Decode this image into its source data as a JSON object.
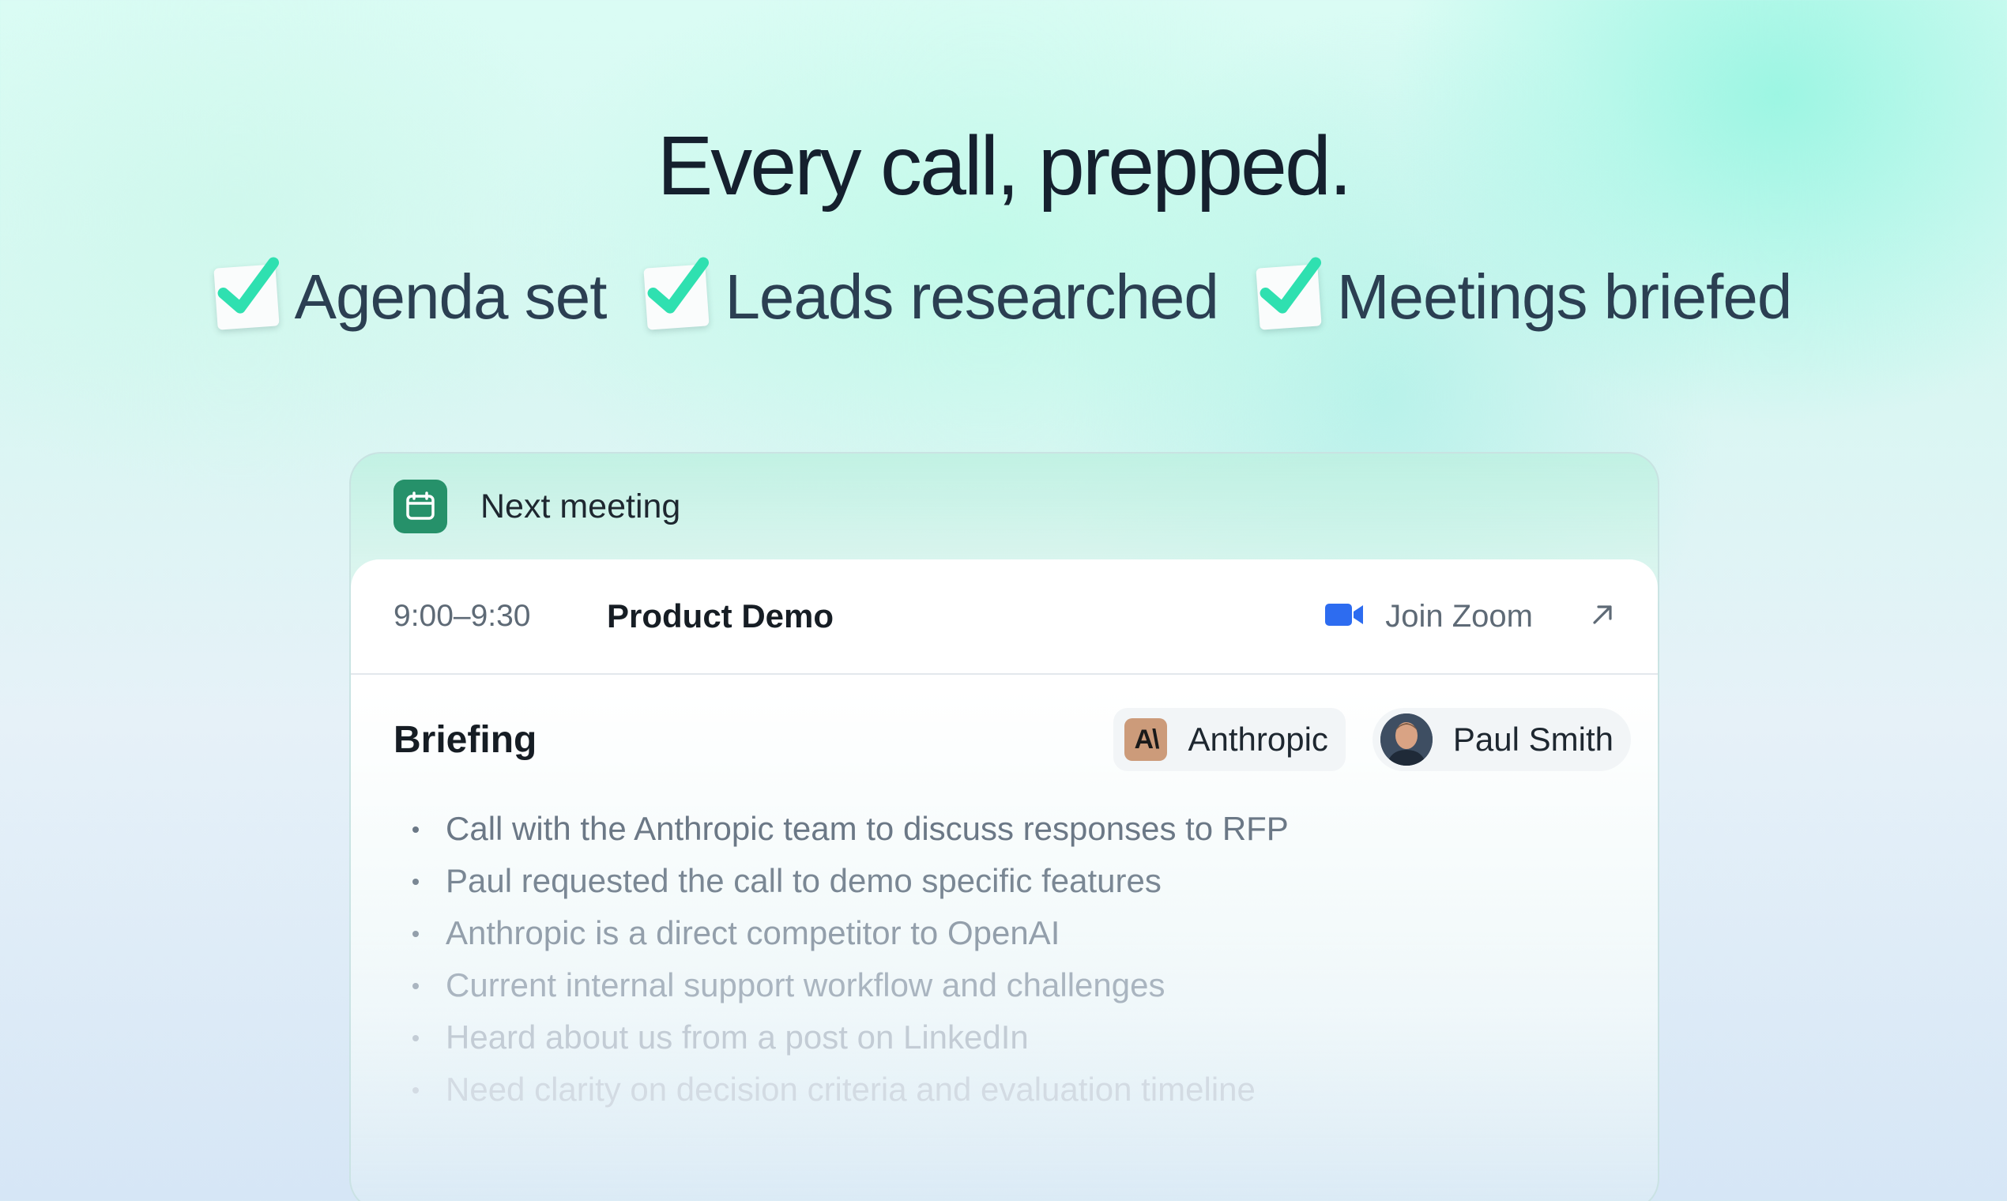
{
  "headline": "Every call, prepped.",
  "checklist": [
    {
      "label": "Agenda set"
    },
    {
      "label": "Leads researched"
    },
    {
      "label": "Meetings briefed"
    }
  ],
  "card": {
    "header_label": "Next meeting",
    "meeting": {
      "time": "9:00–9:30",
      "title": "Product Demo",
      "join_label": "Join Zoom"
    },
    "briefing": {
      "title": "Briefing",
      "company_chip": {
        "logo_text": "A\\",
        "label": "Anthropic"
      },
      "person_chip": {
        "label": "Paul Smith"
      },
      "bullets": [
        "Call with the Anthropic team to discuss responses to RFP",
        "Paul requested the call to demo specific features",
        "Anthropic is a direct competitor to OpenAI",
        "Current internal support workflow and challenges",
        "Heard about us from a post on LinkedIn",
        "Need clarity on decision criteria and evaluation timeline"
      ]
    }
  },
  "colors": {
    "check_green": "#2fe0b0",
    "calendar_green": "#26916a",
    "zoom_blue": "#2d6cf0"
  }
}
